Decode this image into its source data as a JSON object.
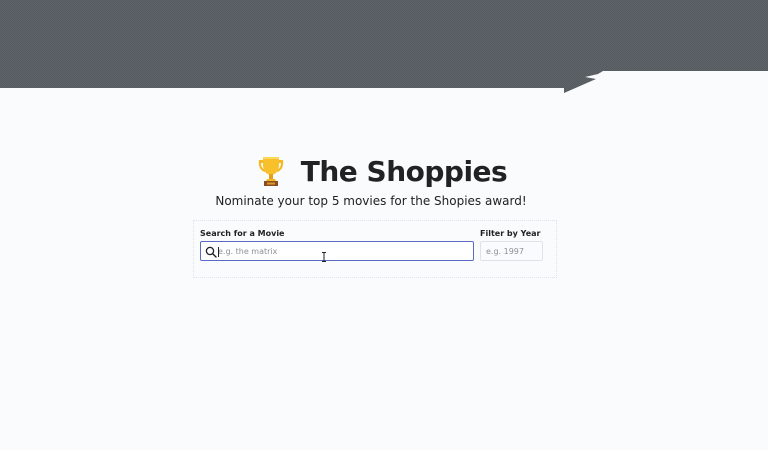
{
  "header": {
    "title": "The Shoppies",
    "subtitle": "Nominate your top 5 movies for the Shopies award!",
    "icon": "trophy-icon"
  },
  "search": {
    "label": "Search for a Movie",
    "value": "",
    "placeholder": "e.g. the matrix",
    "icon": "search-icon"
  },
  "year_filter": {
    "label": "Filter by Year",
    "value": "",
    "placeholder": "e.g. 1997"
  },
  "colors": {
    "accent": "#5c6ac4",
    "text": "#202223",
    "background": "#fafbfc",
    "top_band": "#54595f",
    "trophy_gold": "#f5b722"
  }
}
